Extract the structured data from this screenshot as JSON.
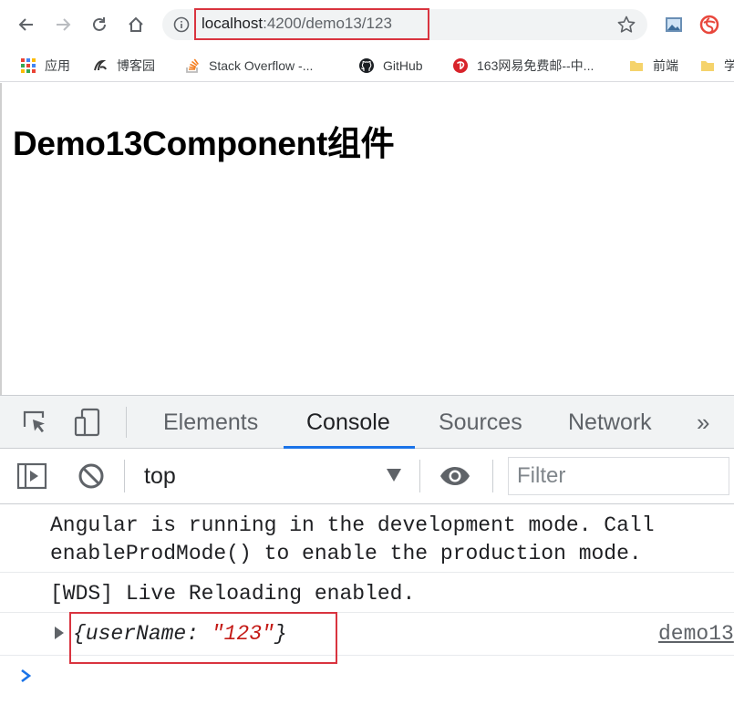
{
  "browser": {
    "url_host": "localhost",
    "url_rest": ":4200/demo13/123",
    "bookmarks": [
      {
        "label": "应用",
        "icon": "apps-grid-icon"
      },
      {
        "label": "博客园",
        "icon": "cnblogs-icon"
      },
      {
        "label": "Stack Overflow -...",
        "icon": "stackoverflow-icon"
      },
      {
        "label": "GitHub",
        "icon": "github-icon"
      },
      {
        "label": "163网易免费邮--中...",
        "icon": "netease-163-icon"
      },
      {
        "label": "前端",
        "icon": "folder-icon"
      },
      {
        "label": "学",
        "icon": "folder-icon"
      }
    ]
  },
  "page": {
    "title": "Demo13Component组件"
  },
  "devtools": {
    "tabs": [
      "Elements",
      "Console",
      "Sources",
      "Network"
    ],
    "active_tab": "Console",
    "context": "top",
    "filter_placeholder": "Filter",
    "messages": {
      "angular_line1": "Angular is running in the development mode. Call",
      "angular_line2": "enableProdMode() to enable the production mode.",
      "wds": "[WDS] Live Reloading enabled.",
      "object_prefix": "{userName: ",
      "object_value": "\"123\"",
      "object_suffix": "}",
      "object_source": "demo13"
    }
  },
  "colors": {
    "highlight_box": "#d9343f",
    "active_tab_underline": "#1a73e8",
    "string_value": "#c41a16"
  }
}
